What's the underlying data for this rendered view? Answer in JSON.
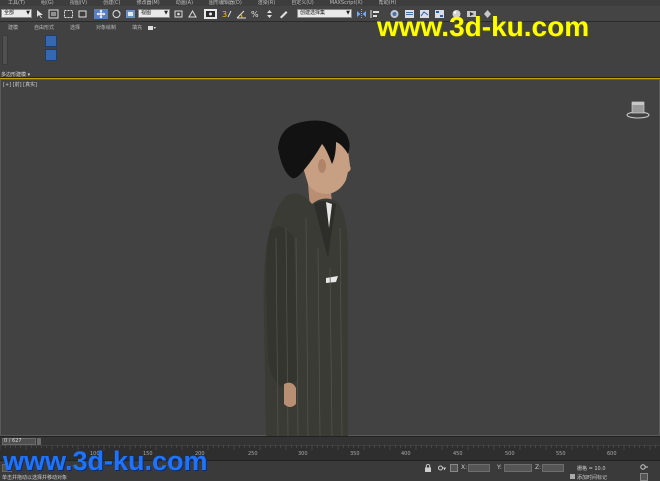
{
  "menu": {
    "items": [
      "工具(T)",
      "组(G)",
      "视图(V)",
      "创建(C)",
      "修改器(M)",
      "动画(A)",
      "图形编辑器(D)",
      "渲染(R)",
      "自定义(U)",
      "MAXScript(X)",
      "帮助(H)"
    ]
  },
  "toolbar": {
    "filter_select": "全部",
    "view_select": "视图",
    "selection_set_placeholder": "创建选择集"
  },
  "ribbon": {
    "tabs": [
      "建模",
      "自由形式",
      "选择",
      "对象绘制",
      "填充"
    ],
    "panel_label": "多边形建模"
  },
  "viewport": {
    "label": "[+] [前] [真实]"
  },
  "trackbar": {
    "frame_counter": "0 / 627",
    "ticks": [
      "100",
      "150",
      "200",
      "250",
      "300",
      "350",
      "400",
      "450",
      "500",
      "550",
      "600"
    ]
  },
  "status": {
    "prompt": "单击并拖动以选择并移动对象",
    "grid_label": "栅格 = 10.0",
    "add_time_tag": "添加时间标记",
    "x_label": "X:",
    "y_label": "Y:",
    "z_label": "Z:"
  },
  "watermark": {
    "top": "www.3d-ku.com",
    "bottom": "www.3d-ku.com"
  },
  "colors": {
    "viewport_bg": "#424242",
    "toolbar_bg": "#444444",
    "watermark_yellow": "#ffff00",
    "watermark_blue": "#1f74ff",
    "accent_blue": "#3568b0"
  },
  "icons": [
    "undo-icon",
    "redo-icon",
    "link-icon",
    "select-icon",
    "move-icon",
    "rotate-icon",
    "scale-icon",
    "snap-icon",
    "mirror-icon",
    "align-icon",
    "render-icon",
    "key-icon",
    "viewcube-icon"
  ]
}
